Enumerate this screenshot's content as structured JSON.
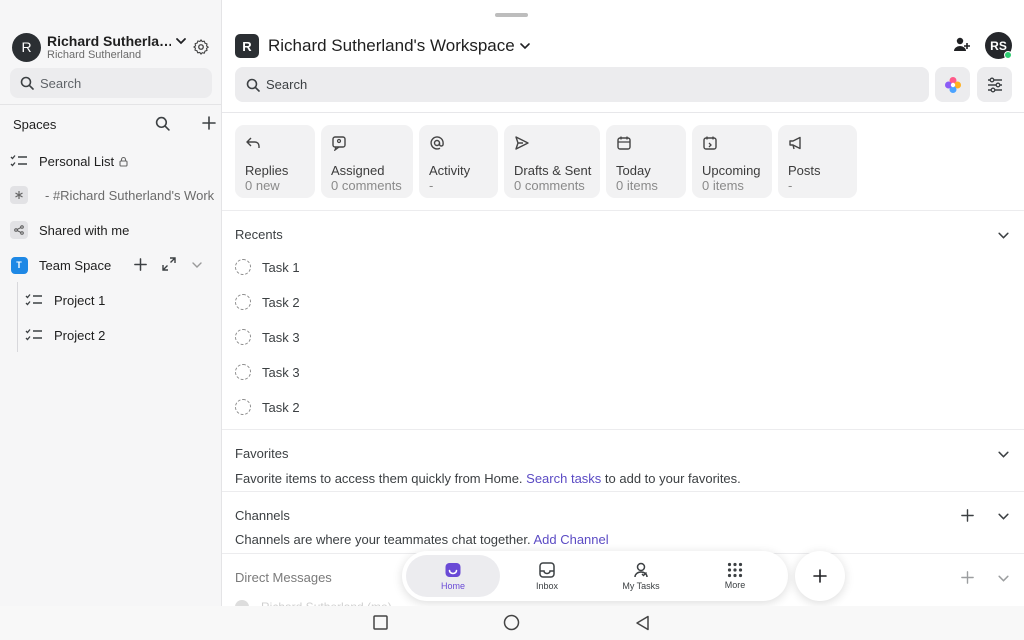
{
  "sidebar": {
    "avatar_letter": "R",
    "workspace_name": "Richard Sutherla…",
    "user_name": "Richard Sutherland",
    "search_placeholder": "Search",
    "spaces_label": "Spaces",
    "items": [
      {
        "label": "Personal List",
        "icon": "checklist-icon",
        "locked": true
      },
      {
        "label": "- #Richard Sutherland's Work",
        "icon": "asterisk-icon"
      },
      {
        "label": "Shared with me",
        "icon": "share-icon"
      },
      {
        "label": "Team Space",
        "icon": "T",
        "icon_color": "#1e88e5"
      },
      {
        "label": "Project 1",
        "icon": "checklist-icon"
      },
      {
        "label": "Project 2",
        "icon": "checklist-icon"
      }
    ]
  },
  "header": {
    "workspace_letter": "R",
    "title": "Richard Sutherland's Workspace",
    "user_initials": "RS",
    "search_placeholder": "Search"
  },
  "cards": [
    {
      "title": "Replies",
      "sub": "0 new",
      "icon": "reply-icon"
    },
    {
      "title": "Assigned",
      "sub": "0 comments",
      "icon": "assigned-icon"
    },
    {
      "title": "Activity",
      "sub": "-",
      "icon": "at-icon"
    },
    {
      "title": "Drafts & Sent",
      "sub": "0 comments",
      "icon": "send-icon"
    },
    {
      "title": "Today",
      "sub": "0 items",
      "icon": "calendar-icon"
    },
    {
      "title": "Upcoming",
      "sub": "0 items",
      "icon": "calendar-upcoming-icon"
    },
    {
      "title": "Posts",
      "sub": "-",
      "icon": "megaphone-icon"
    }
  ],
  "recents": {
    "title": "Recents",
    "tasks": [
      "Task 1",
      "Task 2",
      "Task 3",
      "Task 3",
      "Task 2"
    ]
  },
  "favorites": {
    "title": "Favorites",
    "text_before": "Favorite items to access them quickly from Home. ",
    "link": "Search tasks",
    "text_after": " to add to your favorites."
  },
  "channels": {
    "title": "Channels",
    "text": "Channels are where your teammates chat together. ",
    "link": "Add Channel"
  },
  "direct_messages": {
    "title": "Direct Messages",
    "faded_row": "Richard Sutherland (me)"
  },
  "bottom_nav": [
    {
      "label": "Home",
      "icon": "home-icon",
      "active": true
    },
    {
      "label": "Inbox",
      "icon": "inbox-icon",
      "active": false
    },
    {
      "label": "My Tasks",
      "icon": "my-tasks-icon",
      "active": false
    },
    {
      "label": "More",
      "icon": "grid-dots-icon",
      "active": false
    }
  ],
  "colors": {
    "accent": "#5b4bc4",
    "active_nav": "#6a4ad6",
    "team_space": "#1e88e5",
    "online": "#2ecc71"
  }
}
